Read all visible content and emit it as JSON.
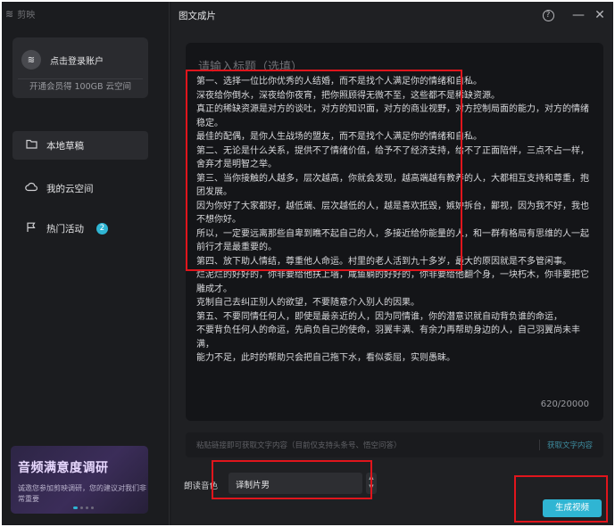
{
  "app": {
    "brand_name": "剪映"
  },
  "sidebar": {
    "login_label": "点击登录账户",
    "avatar_glyph": "≋",
    "vip_text": "开通会员得 100GB 云空间",
    "items": [
      {
        "label": "本地草稿",
        "icon": "folder-icon"
      },
      {
        "label": "我的云空间",
        "icon": "cloud-icon"
      },
      {
        "label": "热门活动",
        "icon": "flag-icon",
        "badge": "2"
      }
    ],
    "banner": {
      "title": "音频满意度调研",
      "subtitle": "诚邀您参加剪映调研，您的建议对我们非常重要"
    }
  },
  "panel": {
    "title": "图文成片",
    "help_glyph": "?",
    "minimize_glyph": "—",
    "close_glyph": "✕"
  },
  "editor": {
    "title_placeholder": "请输入标题（选填）",
    "lines": [
      "第一、选择一位比你优秀的人结婚，而不是找个人满足你的情绪和自私。",
      "深夜给你倒水，深夜给你夜宵，把你照顾得无微不至，这些都不是稀缺资源。",
      "真正的稀缺资源是对方的谈吐，对方的知识面，对方的商业视野，对方控制局面的能力，对方的情绪稳定。",
      "最佳的配偶，是你人生战场的盟友，而不是找个人满足你的情绪和自私。",
      "第二、无论是什么关系，提供不了情绪价值，给予不了经济支持，给不了正面陪伴，三点不占一样，舍弃才是明智之举。",
      "第三、当你接触的人越多，层次越高，你就会发现，越高端越有教养的人，大都相互支持和尊重，抱团发展。",
      "因为你好了大家都好，越低端、层次越低的人，越是喜欢抵毁，嫉妒拆台，鄙视，因为我不好，我也不想你好。",
      "所以，一定要远离那些自卑到瞧不起自己的人，多接近给你能量的人，和一群有格局有思维的人一起前行才是最重要的。",
      "第四、放下助人情结，尊重他人命运。村里的老人活到九十多岁，最大的原因就是不多管闲事。",
      "烂泥烂的好好的，你非要给他扶上墙，咸鱼躺的好好的，你非要给他翻个身，一块朽木，你非要把它雕成才。",
      "克制自己去纠正别人的欲望，不要随意介入别人的因果。",
      "第五、不要同情任何人，即使是最亲近的人，因为同情谁，你的潜意识就自动背负谁的命运，",
      "不要背负任何人的命运，先肩负自己的使命，羽翼丰满、有余力再帮助身边的人，自己羽翼尚未丰满，",
      "能力不足，此时的帮助只会把自己拖下水，看似委屈，实则愚昧。"
    ],
    "counter": "620/20000"
  },
  "link_input": {
    "placeholder": "粘贴链接即可获取文字内容（目前仅支持头条号、悟空问答）",
    "button_label": "获取文字内容"
  },
  "voice": {
    "label": "朗读音色",
    "selected": "译制片男"
  },
  "generate_button": {
    "label": "生成视频"
  },
  "colors": {
    "accent": "#2fb5d3",
    "annotation": "#e0151c",
    "background": "#1b1c1f"
  }
}
